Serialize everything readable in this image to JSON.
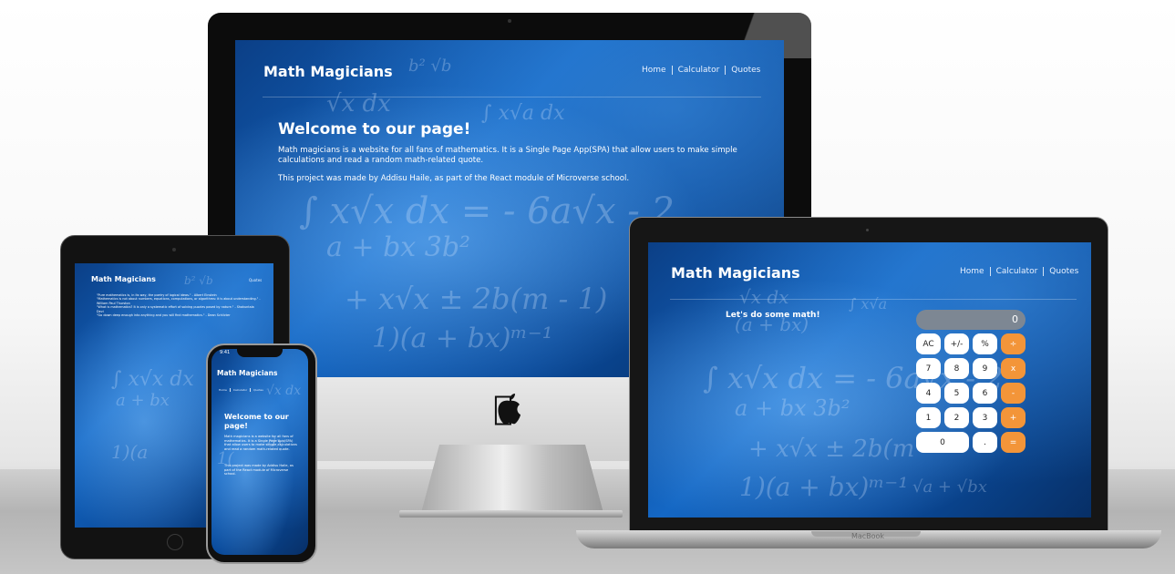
{
  "site": {
    "brand": "Math Magicians",
    "nav": [
      "Home",
      "Calculator",
      "Quotes"
    ]
  },
  "desktop": {
    "welcome_title": "Welcome to our page!",
    "intro": "Math magicians is a website for all fans of mathematics. It is a Single Page App(SPA) that allow users to make simple calculations and read a random math-related quote.",
    "credit": "This project was made by Addisu Haile, as part of the React module of Microverse school."
  },
  "laptop": {
    "calc_title": "Let's do some math!",
    "display": "0",
    "keys": [
      {
        "label": "AC",
        "op": false
      },
      {
        "label": "+/-",
        "op": false
      },
      {
        "label": "%",
        "op": false
      },
      {
        "label": "÷",
        "op": true
      },
      {
        "label": "7",
        "op": false
      },
      {
        "label": "8",
        "op": false
      },
      {
        "label": "9",
        "op": false
      },
      {
        "label": "x",
        "op": true
      },
      {
        "label": "4",
        "op": false
      },
      {
        "label": "5",
        "op": false
      },
      {
        "label": "6",
        "op": false
      },
      {
        "label": "-",
        "op": true
      },
      {
        "label": "1",
        "op": false
      },
      {
        "label": "2",
        "op": false
      },
      {
        "label": "3",
        "op": false
      },
      {
        "label": "+",
        "op": true
      },
      {
        "label": "0",
        "op": false,
        "wide": true
      },
      {
        "label": ".",
        "op": false
      },
      {
        "label": "=",
        "op": true
      }
    ],
    "device_label": "MacBook"
  },
  "tablet": {
    "quotes": [
      "\"Pure mathematics is, in its way, the poetry of logical ideas.\" - Albert Einstein",
      "\"Mathematics is not about numbers, equations, computations, or algorithms: it is about understanding.\" - William Paul Thurston",
      "\"What is mathematics? It is only a systematic effort of solving puzzles posed by nature.\" - Shakuntala Devi",
      "\"Go down deep enough into anything and you will find mathematics.\" - Dean Schlicter"
    ],
    "nav_visible": "Quotes"
  },
  "phone": {
    "time": "9:41",
    "welcome_title": "Welcome to our page!",
    "intro": "Math magicians is a website for all fans of mathematics. It is a Single Page App(SPA) that allow users to make simple calculations and read a random math-related quote.",
    "credit": "This project was made by Addisu Haile, as part of the React module of Microverse school."
  },
  "colors": {
    "operator_key": "#f39539",
    "display": "#7d8793",
    "accent_blue": "#1467c4"
  }
}
